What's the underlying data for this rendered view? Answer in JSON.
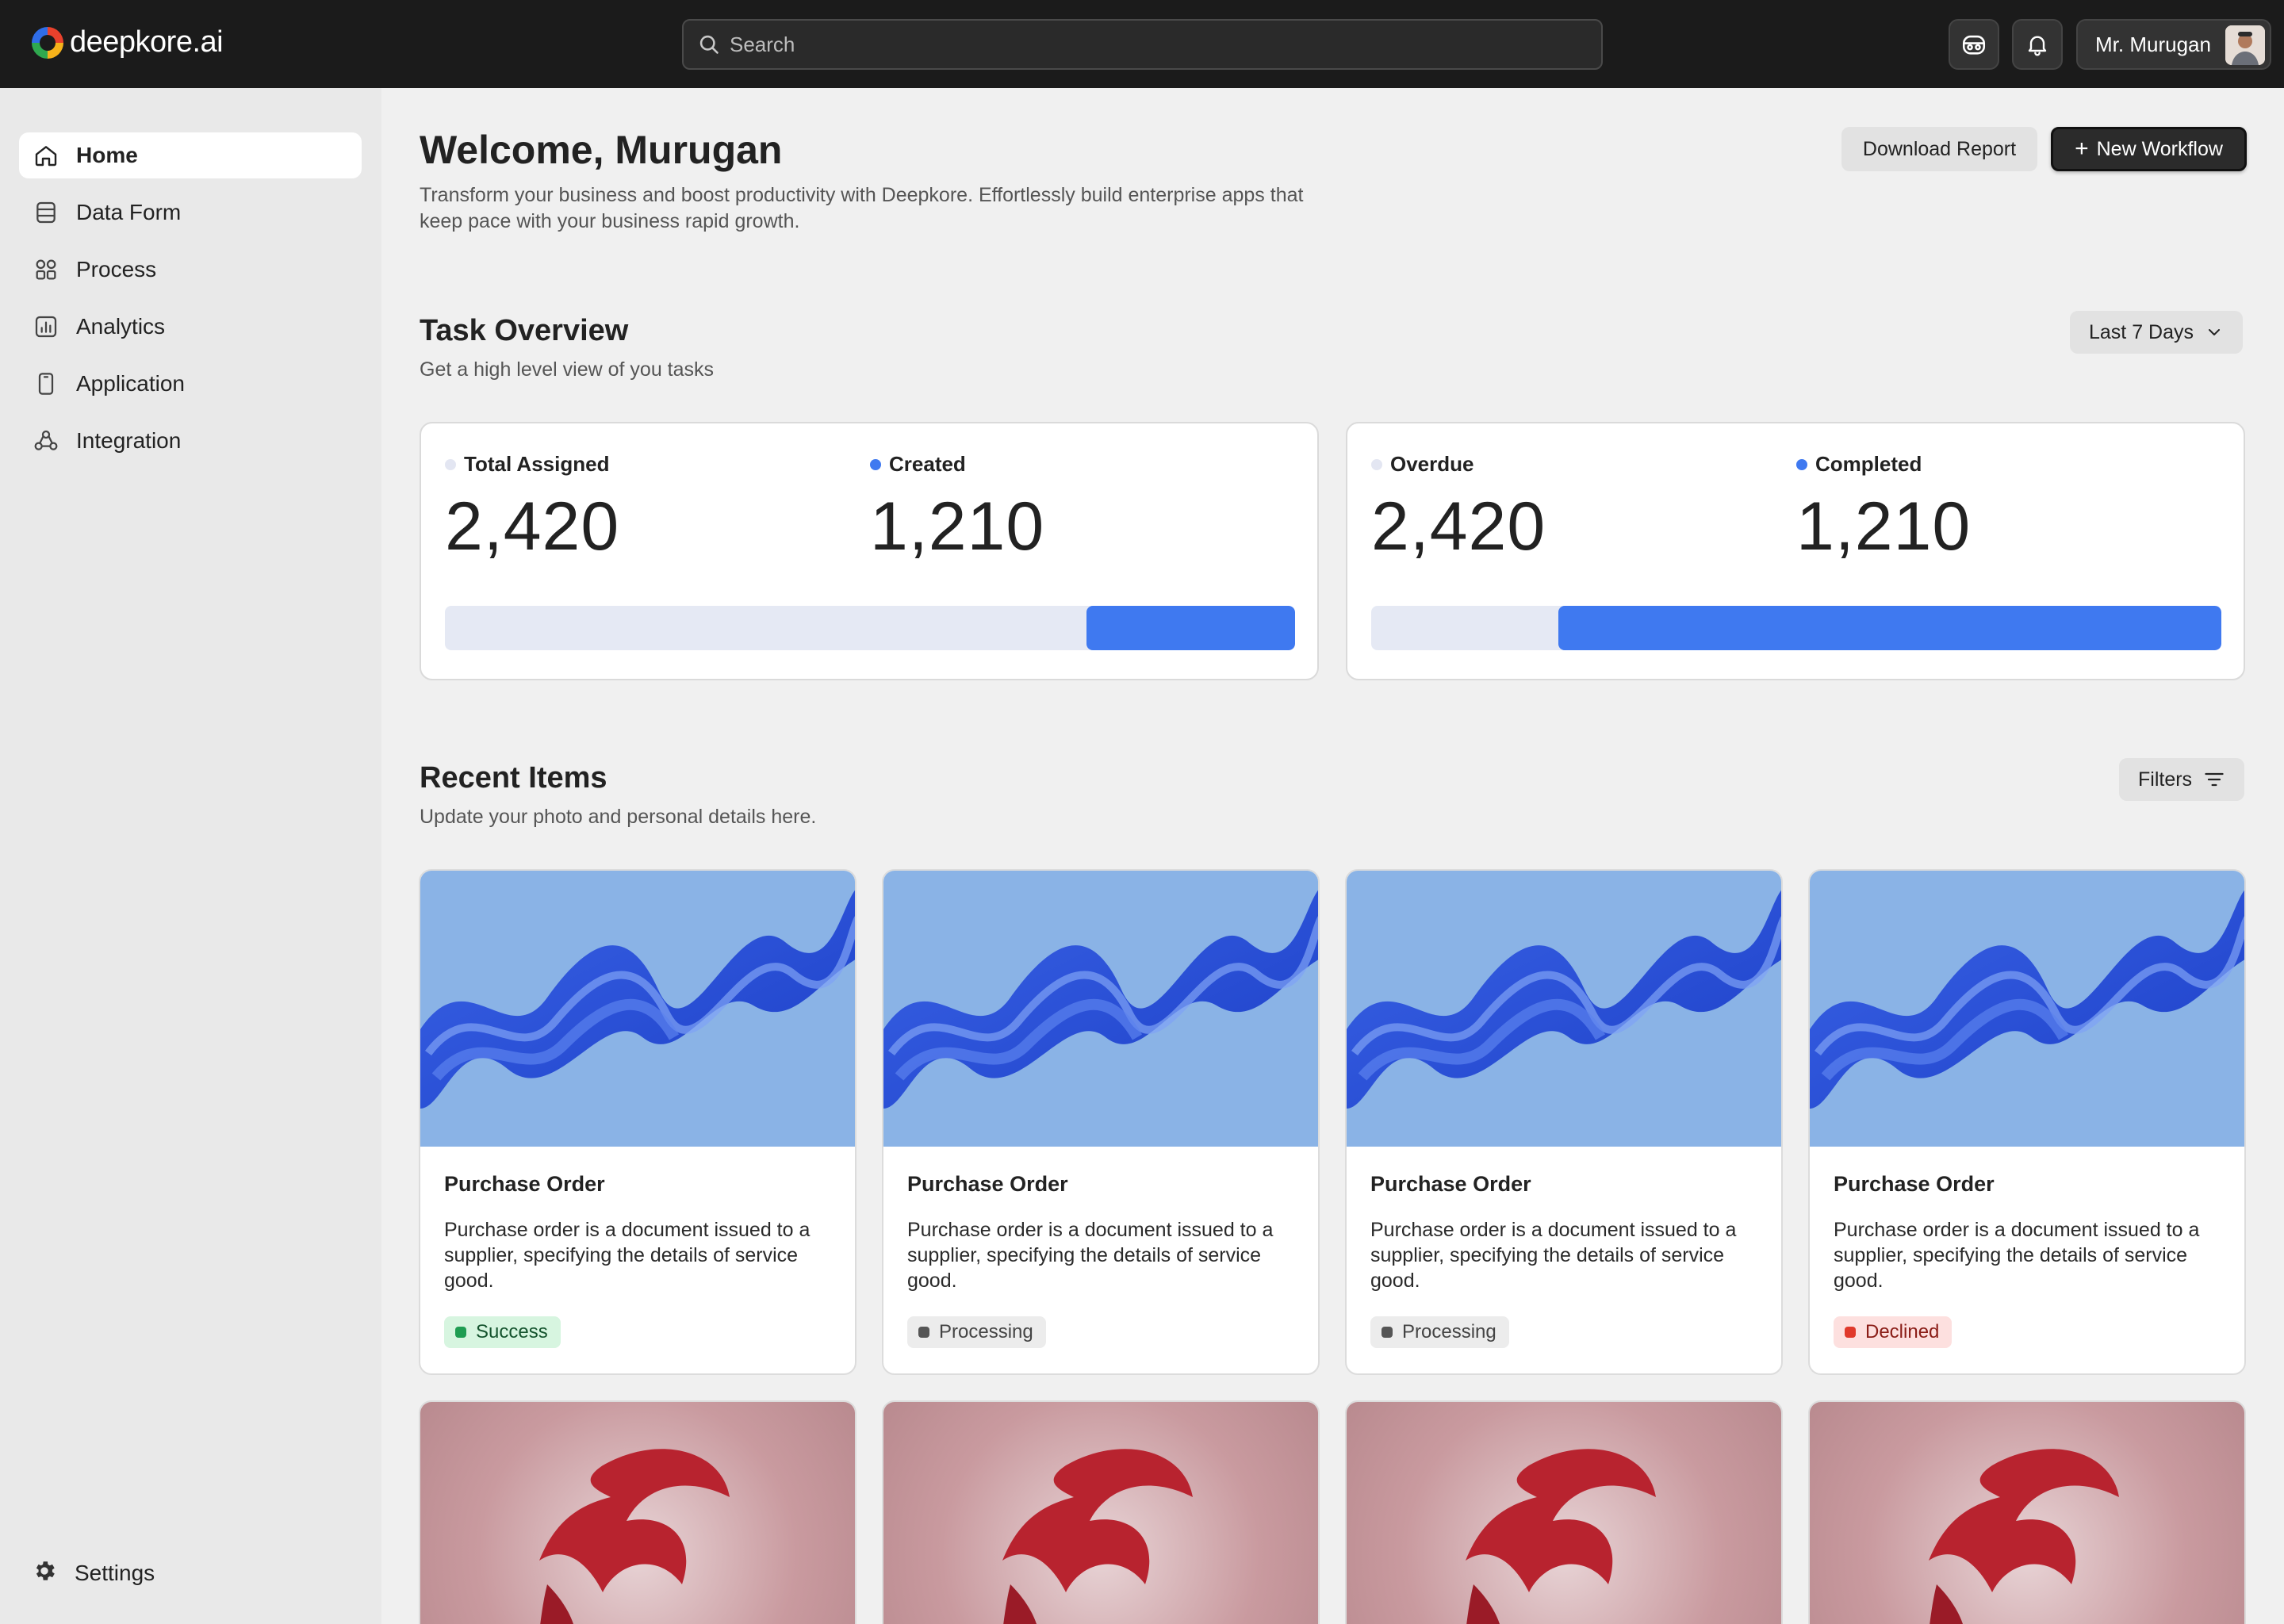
{
  "app": {
    "logo_text": "deepkore.ai"
  },
  "topbar": {
    "search_placeholder": "Search",
    "user_name": "Mr. Murugan"
  },
  "sidebar": {
    "items": [
      {
        "label": "Home",
        "icon": "home-icon",
        "active": true
      },
      {
        "label": "Data Form",
        "icon": "database-icon"
      },
      {
        "label": "Process",
        "icon": "process-icon"
      },
      {
        "label": "Analytics",
        "icon": "analytics-icon"
      },
      {
        "label": "Application",
        "icon": "mobile-icon"
      },
      {
        "label": "Integration",
        "icon": "integration-icon"
      }
    ],
    "settings_label": "Settings"
  },
  "header": {
    "title": "Welcome, Murugan",
    "subtitle": "Transform your business and boost productivity with Deepkore. Effortlessly build enterprise apps that keep pace with your business rapid growth.",
    "download_label": "Download Report",
    "new_workflow_label": "New Workflow"
  },
  "task_overview": {
    "title": "Task Overview",
    "subtitle": "Get a high level view of you tasks",
    "range_label": "Last 7 Days",
    "cards": [
      {
        "stats": [
          {
            "label": "Total Assigned",
            "value": "2,420"
          },
          {
            "label": "Created",
            "value": "1,210"
          }
        ],
        "progress_fraction": 0.245
      },
      {
        "stats": [
          {
            "label": "Overdue",
            "value": "2,420"
          },
          {
            "label": "Completed",
            "value": "1,210"
          }
        ],
        "progress_fraction": 0.78
      }
    ]
  },
  "recent_items": {
    "title": "Recent Items",
    "subtitle": "Update your photo and personal details here.",
    "filters_label": "Filters",
    "items": [
      {
        "title": "Purchase Order",
        "description": "Purchase order is a document issued to a supplier, specifying the details of service good.",
        "status": "Success"
      },
      {
        "title": "Purchase Order",
        "description": "Purchase order is a document issued to a supplier, specifying the details of service good.",
        "status": "Processing"
      },
      {
        "title": "Purchase Order",
        "description": "Purchase order is a document issued to a supplier, specifying the details of service good.",
        "status": "Processing"
      },
      {
        "title": "Purchase Order",
        "description": "Purchase order is a document issued to a supplier, specifying the details of service good.",
        "status": "Declined"
      }
    ]
  },
  "colors": {
    "topbar": "#1b1b1b",
    "accent_blue": "#3f79f0",
    "success": "#1f9d52",
    "declined": "#e0392b"
  }
}
